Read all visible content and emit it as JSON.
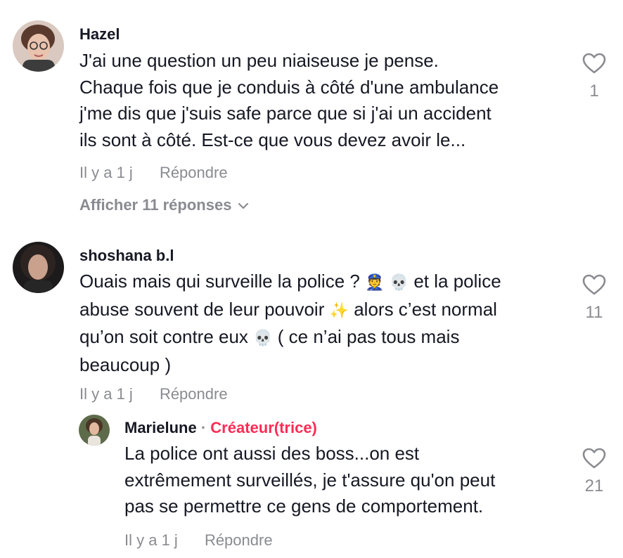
{
  "comments": [
    {
      "username": "Hazel",
      "lines": [
        "J'ai une question un peu niaiseuse je pense.",
        "Chaque fois que je conduis à côté d'une ambulance",
        "j'me dis que j'suis safe parce que si j'ai un accident",
        "ils sont à côté. Est-ce que vous devez avoir le..."
      ],
      "time": "Il y a 1 j",
      "reply_label": "Répondre",
      "likes": "1",
      "view_replies": "Afficher 11 réponses"
    },
    {
      "username": "shoshana b.l",
      "text_parts": [
        "Ouais mais qui surveille la police ? ",
        "👮",
        " ",
        "💀",
        " et la police",
        "abuse souvent de leur pouvoir ",
        "✨",
        " alors c’est normal",
        "qu’on soit contre eux ",
        "💀",
        " ( ce n’ai pas tous mais",
        "beaucoup )"
      ],
      "time": "Il y a 1 j",
      "reply_label": "Répondre",
      "likes": "11"
    },
    {
      "username": "Marielune",
      "separator": "·",
      "badge": "Créateur(trice)",
      "lines": [
        "La police ont aussi des boss...on est",
        "extrêmement surveillés, je t'assure qu'on peut",
        "pas se permettre ce gens de comportement."
      ],
      "time": "Il y a 1 j",
      "reply_label": "Répondre",
      "likes": "21"
    }
  ],
  "icons": {
    "like": "heart-outline-icon",
    "expand": "chevron-down-icon"
  },
  "colors": {
    "text": "#161823",
    "muted": "#8a8b91",
    "creator_badge": "#fe2c55"
  }
}
